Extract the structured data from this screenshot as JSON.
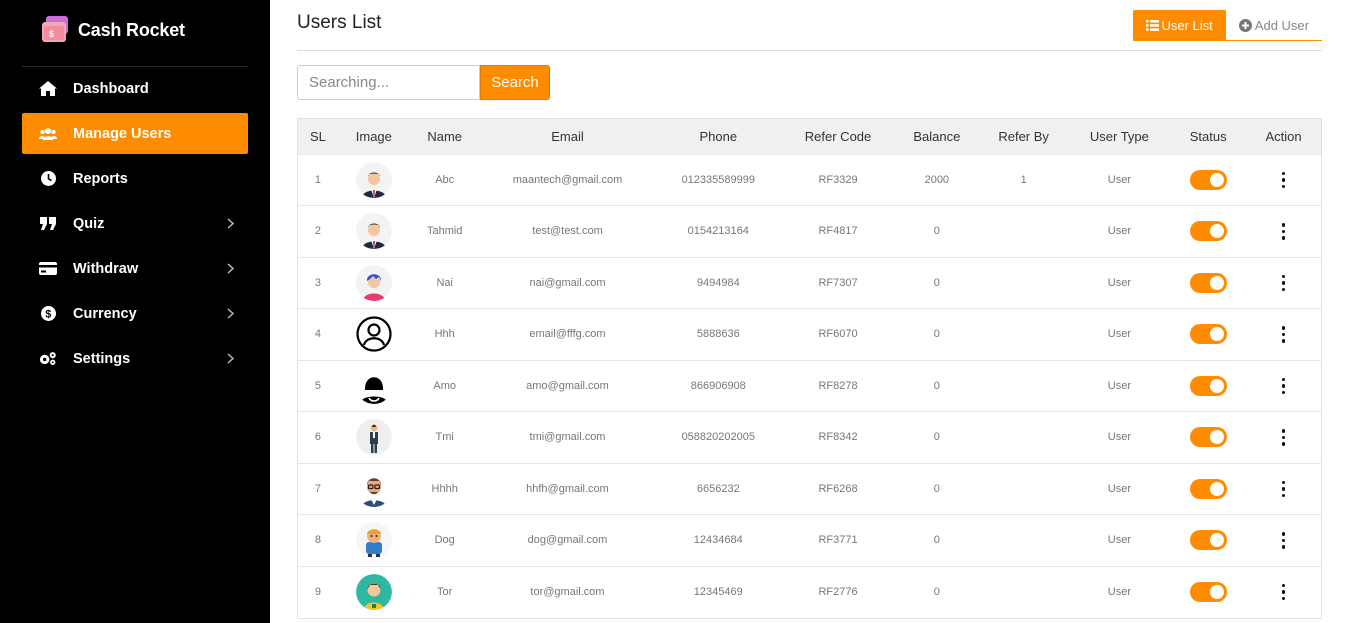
{
  "brand": {
    "name": "Cash Rocket"
  },
  "sidebar": {
    "items": [
      {
        "label": "Dashboard",
        "icon": "home-icon",
        "active": false,
        "submenu": false
      },
      {
        "label": "Manage Users",
        "icon": "users-icon",
        "active": true,
        "submenu": false
      },
      {
        "label": "Reports",
        "icon": "clock-icon",
        "active": false,
        "submenu": false
      },
      {
        "label": "Quiz",
        "icon": "quote-icon",
        "active": false,
        "submenu": true
      },
      {
        "label": "Withdraw",
        "icon": "credit-card-icon",
        "active": false,
        "submenu": true
      },
      {
        "label": "Currency",
        "icon": "dollar-icon",
        "active": false,
        "submenu": true
      },
      {
        "label": "Settings",
        "icon": "cogs-icon",
        "active": false,
        "submenu": true
      }
    ]
  },
  "page": {
    "title": "Users List"
  },
  "tabs": {
    "user_list": "User List",
    "add_user": "Add User"
  },
  "search": {
    "placeholder": "Searching...",
    "button": "Search"
  },
  "table": {
    "headers": [
      "SL",
      "Image",
      "Name",
      "Email",
      "Phone",
      "Refer Code",
      "Balance",
      "Refer By",
      "User Type",
      "Status",
      "Action"
    ],
    "rows": [
      {
        "sl": "1",
        "avatar": "man-suit-avatar",
        "name": "Abc",
        "email": "maantech@gmail.com",
        "phone": "012335589999",
        "refer_code": "RF3329",
        "balance": "2000",
        "refer_by": "1",
        "user_type": "User",
        "status": true
      },
      {
        "sl": "2",
        "avatar": "man-suit-avatar",
        "name": "Tahmid",
        "email": "test@test.com",
        "phone": "0154213164",
        "refer_code": "RF4817",
        "balance": "0",
        "refer_by": "",
        "user_type": "User",
        "status": true
      },
      {
        "sl": "3",
        "avatar": "blue-hair-avatar",
        "name": "Nai",
        "email": "nai@gmail.com",
        "phone": "9494984",
        "refer_code": "RF7307",
        "balance": "0",
        "refer_by": "",
        "user_type": "User",
        "status": true
      },
      {
        "sl": "4",
        "avatar": "user-outline-avatar",
        "name": "Hhh",
        "email": "email@fffg.com",
        "phone": "5888636",
        "refer_code": "RF6070",
        "balance": "0",
        "refer_by": "",
        "user_type": "User",
        "status": true
      },
      {
        "sl": "5",
        "avatar": "woman-silhouette-avatar",
        "name": "Amo",
        "email": "amo@gmail.com",
        "phone": "866906908",
        "refer_code": "RF8278",
        "balance": "0",
        "refer_by": "",
        "user_type": "User",
        "status": true
      },
      {
        "sl": "6",
        "avatar": "standing-man-avatar",
        "name": "Tmi",
        "email": "tmi@gmail.com",
        "phone": "058820202005",
        "refer_code": "RF8342",
        "balance": "0",
        "refer_by": "",
        "user_type": "User",
        "status": true
      },
      {
        "sl": "7",
        "avatar": "glasses-man-avatar",
        "name": "Hhhh",
        "email": "hhfh@gmail.com",
        "phone": "6656232",
        "refer_code": "RF6268",
        "balance": "0",
        "refer_by": "",
        "user_type": "User",
        "status": true
      },
      {
        "sl": "8",
        "avatar": "cartoon-man-avatar",
        "name": "Dog",
        "email": "dog@gmail.com",
        "phone": "12434684",
        "refer_code": "RF3771",
        "balance": "0",
        "refer_by": "",
        "user_type": "User",
        "status": true
      },
      {
        "sl": "9",
        "avatar": "teal-circle-avatar",
        "name": "Tor",
        "email": "tor@gmail.com",
        "phone": "12345469",
        "refer_code": "RF2776",
        "balance": "0",
        "refer_by": "",
        "user_type": "User",
        "status": true
      }
    ]
  },
  "colors": {
    "accent": "#ff8c00",
    "sidebar_bg": "#000000",
    "header_bg": "#f0f0f0"
  }
}
